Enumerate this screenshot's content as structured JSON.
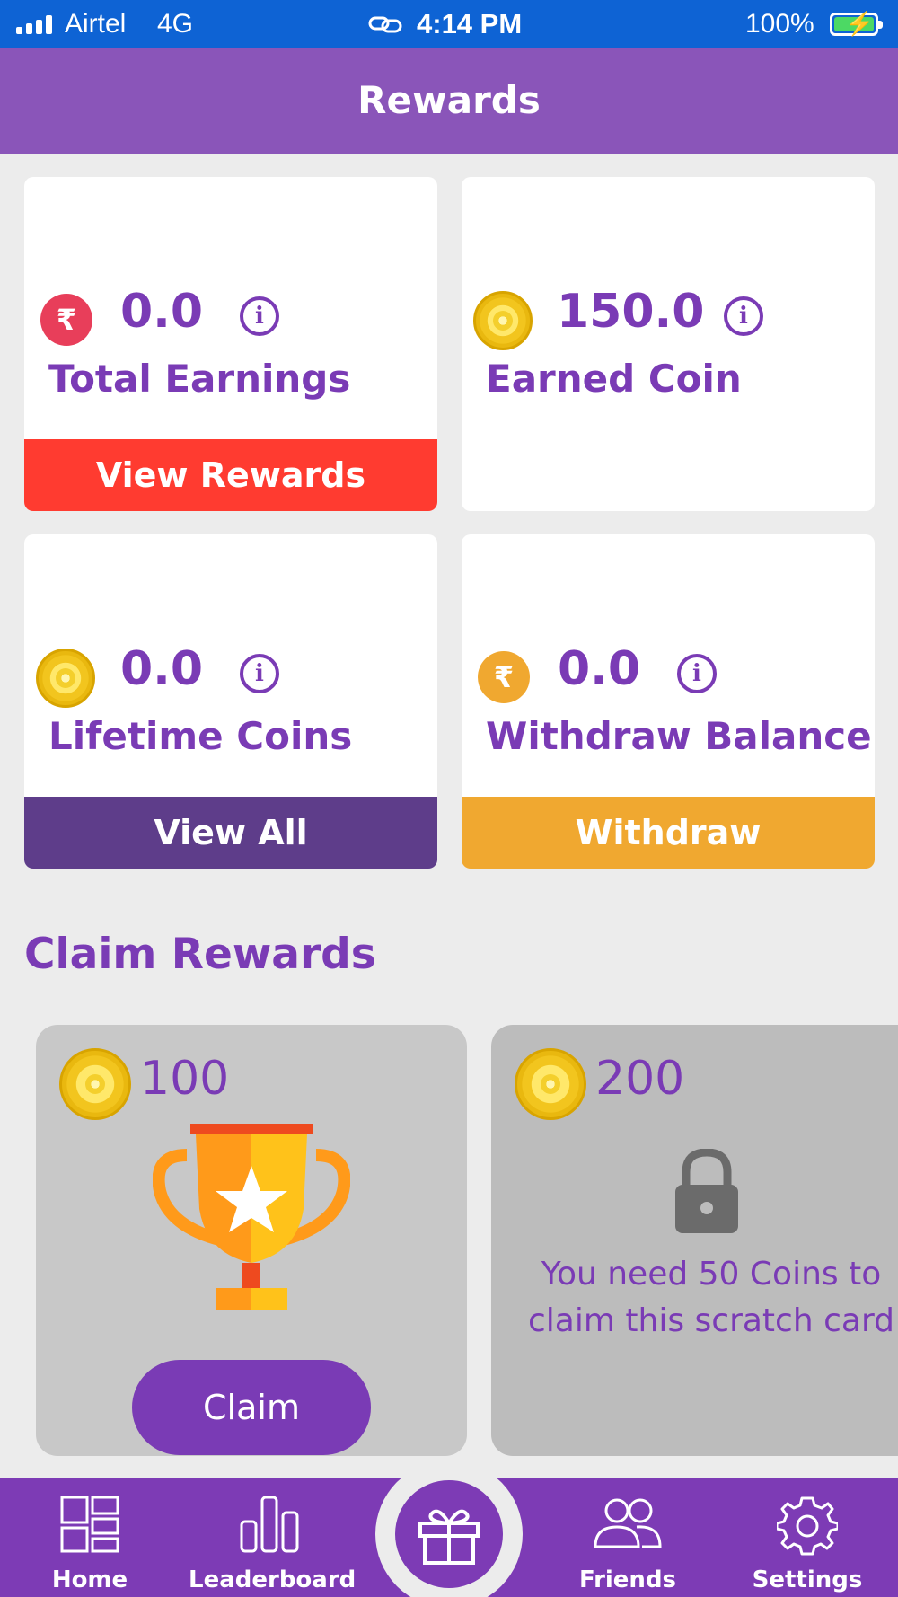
{
  "status_bar": {
    "carrier": "Airtel",
    "network": "4G",
    "time": "4:14 PM",
    "battery": "100%"
  },
  "header": {
    "title": "Rewards"
  },
  "cards": [
    {
      "value": "0.0",
      "label": "Total Earnings",
      "icon": "rupee-icon",
      "icon_color": "#e83e5a",
      "button": "View Rewards",
      "button_color": "#ff3b30"
    },
    {
      "value": "150.0",
      "label": "Earned Coin",
      "icon": "coin-icon"
    },
    {
      "value": "0.0",
      "label": "Lifetime Coins",
      "icon": "coin-icon",
      "button": "View All",
      "button_color": "#5e3d8a"
    },
    {
      "value": "0.0",
      "label": "Withdraw Balance",
      "icon": "rupee-icon",
      "icon_color": "#f0a830",
      "button": "Withdraw",
      "button_color": "#f0a830"
    }
  ],
  "claim_section": {
    "title": "Claim Rewards",
    "items": [
      {
        "amount": "100",
        "button": "Claim"
      },
      {
        "amount": "200",
        "locked_message": "You need 50 Coins to claim this scratch card"
      }
    ]
  },
  "nav": {
    "items": [
      "Home",
      "Leaderboard",
      "Friends",
      "Settings"
    ]
  },
  "colors": {
    "primary": "#7a3bb5",
    "header": "#8a55b9",
    "status_bar": "#0e63d4"
  }
}
